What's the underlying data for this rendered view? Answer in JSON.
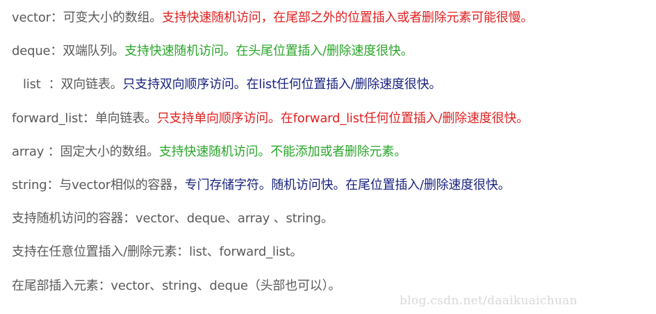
{
  "lines": [
    {
      "prefix": "vector：可变大小的数组。",
      "highlight": "支持快速随机访问，在尾部之外的位置插入或者删除元素可能很慢。"
    },
    {
      "prefix": "deque：双端队列。",
      "highlight": "支持快速随机访问。在头尾位置插入/删除速度很快。"
    },
    {
      "prefix": "list  ：双向链表。",
      "highlight": "只支持双向顺序访问。在list任何位置插入/删除速度很快。"
    },
    {
      "prefix": "forward_list：单向链表。",
      "highlight": "只支持单向顺序访问。在forward_list任何位置插入/删除速度很快。"
    },
    {
      "prefix": "array ：固定大小的数组。",
      "highlight": "支持快速随机访问。不能添加或者删除元素。"
    },
    {
      "prefix": "string：与vector相似的容器，",
      "highlight": "专门存储字符。随机访问快。在尾位置插入/删除速度很快。"
    }
  ],
  "summary": [
    "支持随机访问的容器：vector、deque、array 、string。",
    "支持在任意位置插入/删除元素：list、forward_list。",
    "在尾部插入元素：vector、string、deque（头部也可以）。"
  ],
  "watermark": "blog.csdn.net/daaikuaichuan",
  "colors": {
    "text_gray": "#5a5a5a",
    "red": "#e02020",
    "green": "#2aa52a",
    "navy": "#1a237e",
    "watermark": "#d8d8d8"
  }
}
